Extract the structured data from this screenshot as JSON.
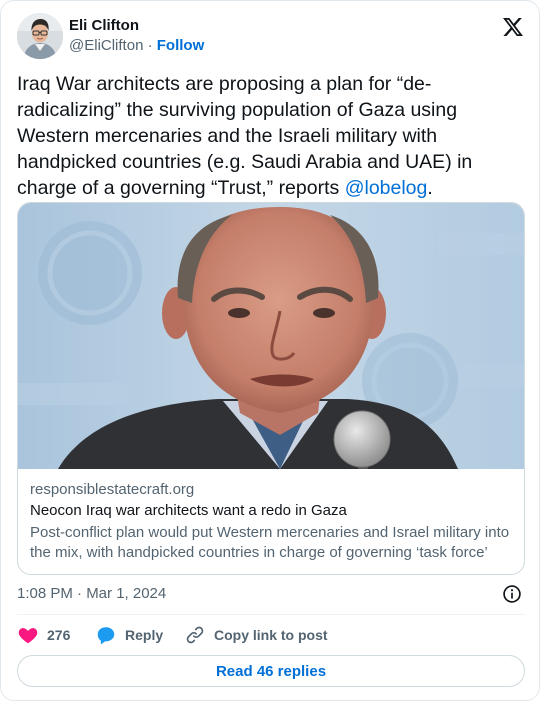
{
  "author": {
    "name": "Eli Clifton",
    "handle": "@EliClifton",
    "separator": " · ",
    "follow_label": "Follow"
  },
  "tweet": {
    "text_main": "Iraq War architects are proposing a plan for “de-radicalizing” the surviving population of Gaza using Western mercenaries and the Israeli military with handpicked countries (e.g. Saudi Arabia and UAE) in charge of a governing “Trust,” reports ",
    "mention": "@lobelog",
    "text_end": "."
  },
  "link_card": {
    "domain": "responsiblestatecraft.org",
    "title": "Neocon Iraq war architects want a redo in Gaza",
    "description": "Post-conflict plan would put Western mercenaries and Israel military into the mix, with handpicked countries in charge of governing ‘task force’"
  },
  "timestamp": "1:08 PM · Mar 1, 2024",
  "actions": {
    "like_count": "276",
    "reply_label": "Reply",
    "copy_label": "Copy link to post"
  },
  "replies_button": "Read 46 replies",
  "icons": {
    "brand": "x-logo-icon",
    "like": "heart-icon",
    "reply": "speech-bubble-icon",
    "copy": "link-icon",
    "info": "info-icon"
  },
  "colors": {
    "link_blue": "#006fd6",
    "heart": "#f91880",
    "reply_bubble": "#1d9bf0",
    "secondary_text": "#536471"
  }
}
